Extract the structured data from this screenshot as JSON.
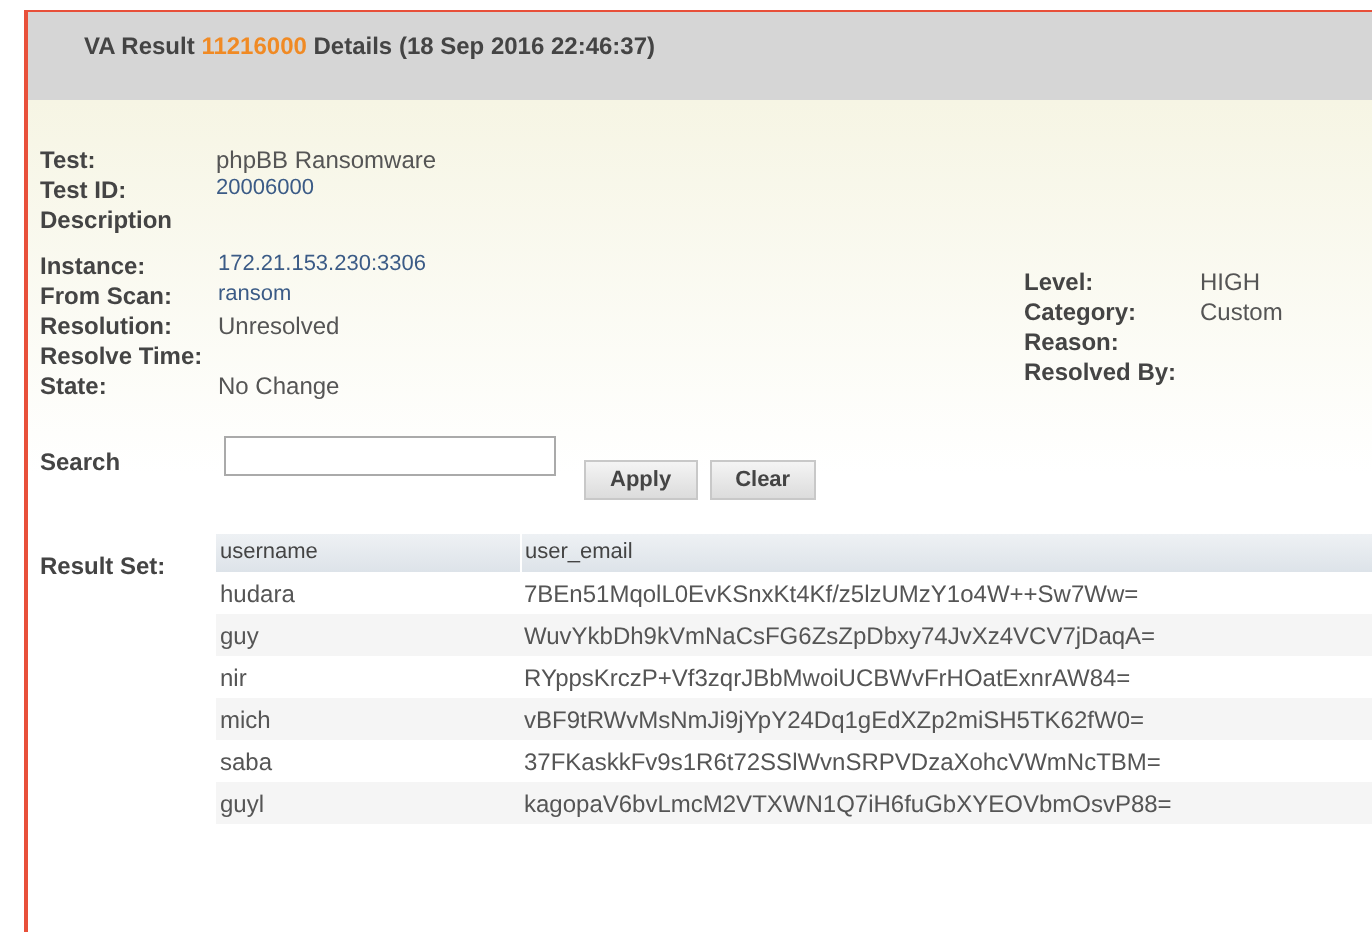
{
  "header": {
    "title_prefix": "VA Result",
    "result_id": "11216000",
    "title_suffix": "Details (18 Sep 2016 22:46:37)"
  },
  "test_fields": [
    {
      "label": "Test:",
      "value": "phpBB Ransomware",
      "kind": "plain"
    },
    {
      "label": "Test ID:",
      "value": "20006000",
      "kind": "link"
    },
    {
      "label": "Description"
    }
  ],
  "instance_fields": [
    {
      "label": "Instance:",
      "value": "172.21.153.230:3306",
      "kind": "link"
    },
    {
      "label": "From Scan:",
      "value": "ransom",
      "kind": "link"
    },
    {
      "label": "Resolution:",
      "value": "Unresolved",
      "kind": "plain"
    },
    {
      "label": "Resolve Time:"
    },
    {
      "label": "State:",
      "value": "No Change",
      "kind": "plain"
    }
  ],
  "level_fields": [
    {
      "label": "Level:",
      "value": "HIGH"
    },
    {
      "label": "Category:",
      "value": "Custom"
    },
    {
      "label": "Reason:"
    },
    {
      "label": "Resolved By:"
    }
  ],
  "search": {
    "label": "Search",
    "buttons": [
      "Apply",
      "Clear"
    ]
  },
  "result_set": {
    "label": "Result Set:",
    "columns": [
      "username",
      "user_email"
    ],
    "rows": [
      [
        "hudara",
        "7BEn51MqolL0EvKSnxKt4Kf/z5lzUMzY1o4W++Sw7Ww="
      ],
      [
        "guy",
        "WuvYkbDh9kVmNaCsFG6ZsZpDbxy74JvXz4VCV7jDaqA="
      ],
      [
        "nir",
        "RYppsKrczP+Vf3zqrJBbMwoiUCBWvFrHOatExnrAW84="
      ],
      [
        "mich",
        "vBF9tRWvMsNmJi9jYpY24Dq1gEdXZp2miSH5TK62fW0="
      ],
      [
        "saba",
        "37FKaskkFv9s1R6t72SSlWvnSRPVDzaXohcVWmNcTBM="
      ],
      [
        "guyl",
        "kagopaV6bvLmcM2VTXWN1Q7iH6fuGbXYEOVbmOsvP88="
      ]
    ]
  }
}
